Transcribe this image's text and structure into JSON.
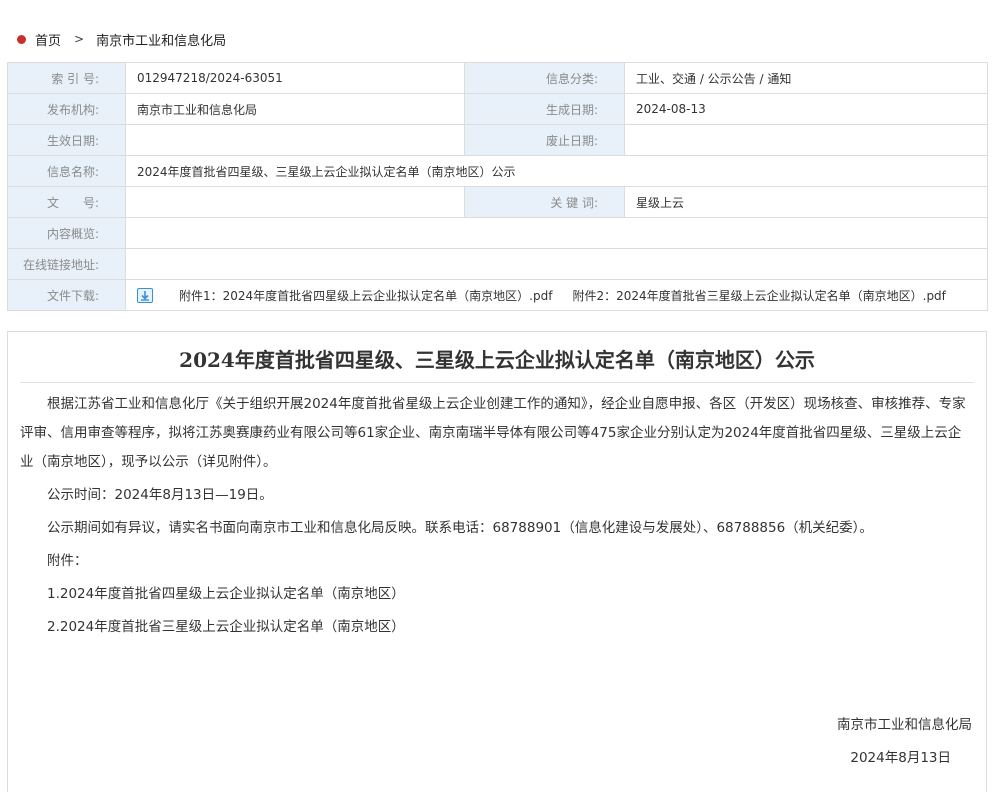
{
  "breadcrumb": {
    "home": "首页",
    "separator": ">",
    "current": "南京市工业和信息化局"
  },
  "info": {
    "index_no_label": "索 引 号:",
    "index_no": "012947218/2024-63051",
    "category_label": "信息分类:",
    "category": "工业、交通 / 公示公告 / 通知",
    "publisher_label": "发布机构:",
    "publisher": "南京市工业和信息化局",
    "generated_label": "生成日期:",
    "generated": "2024-08-13",
    "effective_label": "生效日期:",
    "effective": "",
    "expired_label": "废止日期:",
    "expired": "",
    "name_label": "信息名称:",
    "name": "2024年度首批省四星级、三星级上云企业拟认定名单（南京地区）公示",
    "doc_no_label": "文　　号:",
    "doc_no": "",
    "keywords_label": "关 键 词:",
    "keywords": "星级上云",
    "summary_label": "内容概览:",
    "summary": "",
    "link_label": "在线链接地址:",
    "link": "",
    "download_label": "文件下载:",
    "attachments": [
      "附件1：2024年度首批省四星级上云企业拟认定名单（南京地区）.pdf",
      "附件2：2024年度首批省三星级上云企业拟认定名单（南京地区）.pdf"
    ]
  },
  "article": {
    "title": "2024年度首批省四星级、三星级上云企业拟认定名单（南京地区）公示",
    "paragraphs": [
      "根据江苏省工业和信息化厅《关于组织开展2024年度首批省星级上云企业创建工作的通知》，经企业自愿申报、各区（开发区）现场核查、审核推荐、专家评审、信用审查等程序，拟将江苏奥赛康药业有限公司等61家企业、南京南瑞半导体有限公司等475家企业分别认定为2024年度首批省四星级、三星级上云企业（南京地区），现予以公示（详见附件）。",
      "公示时间：2024年8月13日—19日。",
      "公示期间如有异议，请实名书面向南京市工业和信息化局反映。联系电话：68788901（信息化建设与发展处）、68788856（机关纪委）。",
      "附件：",
      "1.2024年度首批省四星级上云企业拟认定名单（南京地区）",
      "2.2024年度首批省三星级上云企业拟认定名单（南京地区）"
    ],
    "signature_org": "南京市工业和信息化局",
    "signature_date": "2024年8月13日"
  },
  "colors": {
    "label_bg": "#e8f1fa",
    "border": "#dcdcdc",
    "home_dot": "#c8302c",
    "download_icon": "#3b8fd9"
  },
  "icons": {
    "home": "home-dot-icon",
    "download": "download-icon"
  }
}
